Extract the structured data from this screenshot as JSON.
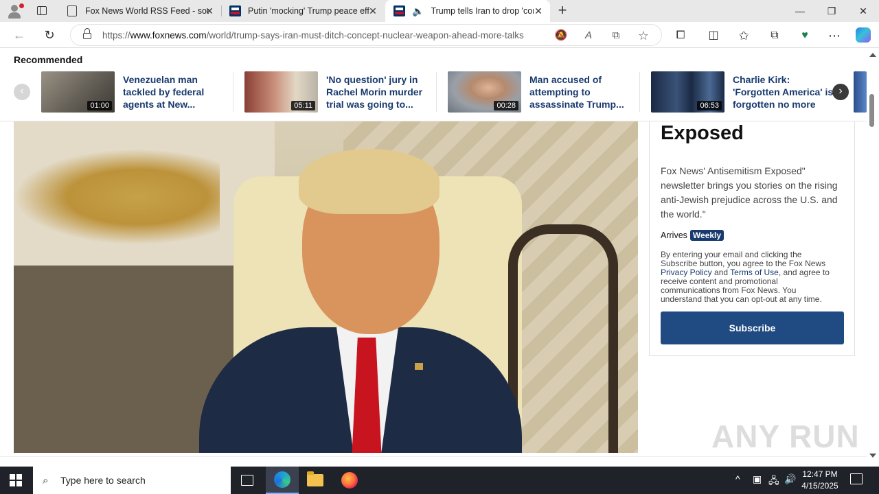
{
  "browser": {
    "tabs": [
      {
        "title": "Fox News World RSS Feed - socc",
        "icon": "document-icon",
        "active": false
      },
      {
        "title": "Putin 'mocking' Trump peace eff",
        "icon": "foxnews-favicon",
        "active": false
      },
      {
        "title": "Trump tells Iran to drop 'con",
        "icon": "foxnews-favicon",
        "active": true,
        "audio": true
      }
    ],
    "close_glyph": "✕",
    "new_tab_glyph": "+",
    "window_controls": {
      "minimize": "—",
      "restore": "❐",
      "close": "✕"
    },
    "address": {
      "scheme": "https://",
      "host": "www.foxnews.com",
      "path": "/world/trump-says-iran-must-ditch-concept-nuclear-weapon-ahead-more-talks"
    },
    "nav": {
      "back": "←",
      "refresh": "↻"
    },
    "toolbar_icons": {
      "mute": "🔕",
      "read_aloud": "A",
      "immersive": "⧉",
      "favorite": "☆",
      "extensions": "⧠",
      "split": "◫",
      "favorites": "✩",
      "collections": "⧉",
      "performance": "♥",
      "menu": "⋯"
    }
  },
  "recommended": {
    "heading": "Recommended",
    "prev_glyph": "‹",
    "next_glyph": "›",
    "items": [
      {
        "headline": "Venezuelan man tackled by federal agents at New...",
        "duration": "01:00",
        "thumb_color": "#7a746a"
      },
      {
        "headline": "'No question' jury in Rachel Morin murder trial was going to...",
        "duration": "05:11",
        "thumb_color": "#a3746a"
      },
      {
        "headline": "Man accused of attempting to assassinate Trump...",
        "duration": "00:28",
        "thumb_color": "#8a8f96"
      },
      {
        "headline": "Charlie Kirk: 'Forgotten America' is forgotten no more",
        "duration": "06:53",
        "thumb_color": "#23344f"
      }
    ]
  },
  "newsletter": {
    "title": "Antisemitism Exposed",
    "description": "Fox News' Antisemitism Exposed\" newsletter brings you stories on the rising anti-Jewish prejudice across the U.S. and the world.\"",
    "arrives_label": "Arrives",
    "frequency": "Weekly",
    "legal_pre": "By entering your email and clicking the Subscribe button, you agree to the Fox News ",
    "privacy_link": "Privacy Policy",
    "legal_and": " and ",
    "terms_link": "Terms of Use",
    "legal_post": ", and agree to receive content and promotional communications from Fox News. You understand that you can opt-out at any time.",
    "subscribe_label": "Subscribe"
  },
  "watermark": "ANY RUN",
  "taskbar": {
    "search_placeholder": "Type here to search",
    "time": "12:47 PM",
    "date": "4/15/2025",
    "tray": {
      "chevron": "^",
      "network": "🖧",
      "volume": "🔊"
    }
  }
}
